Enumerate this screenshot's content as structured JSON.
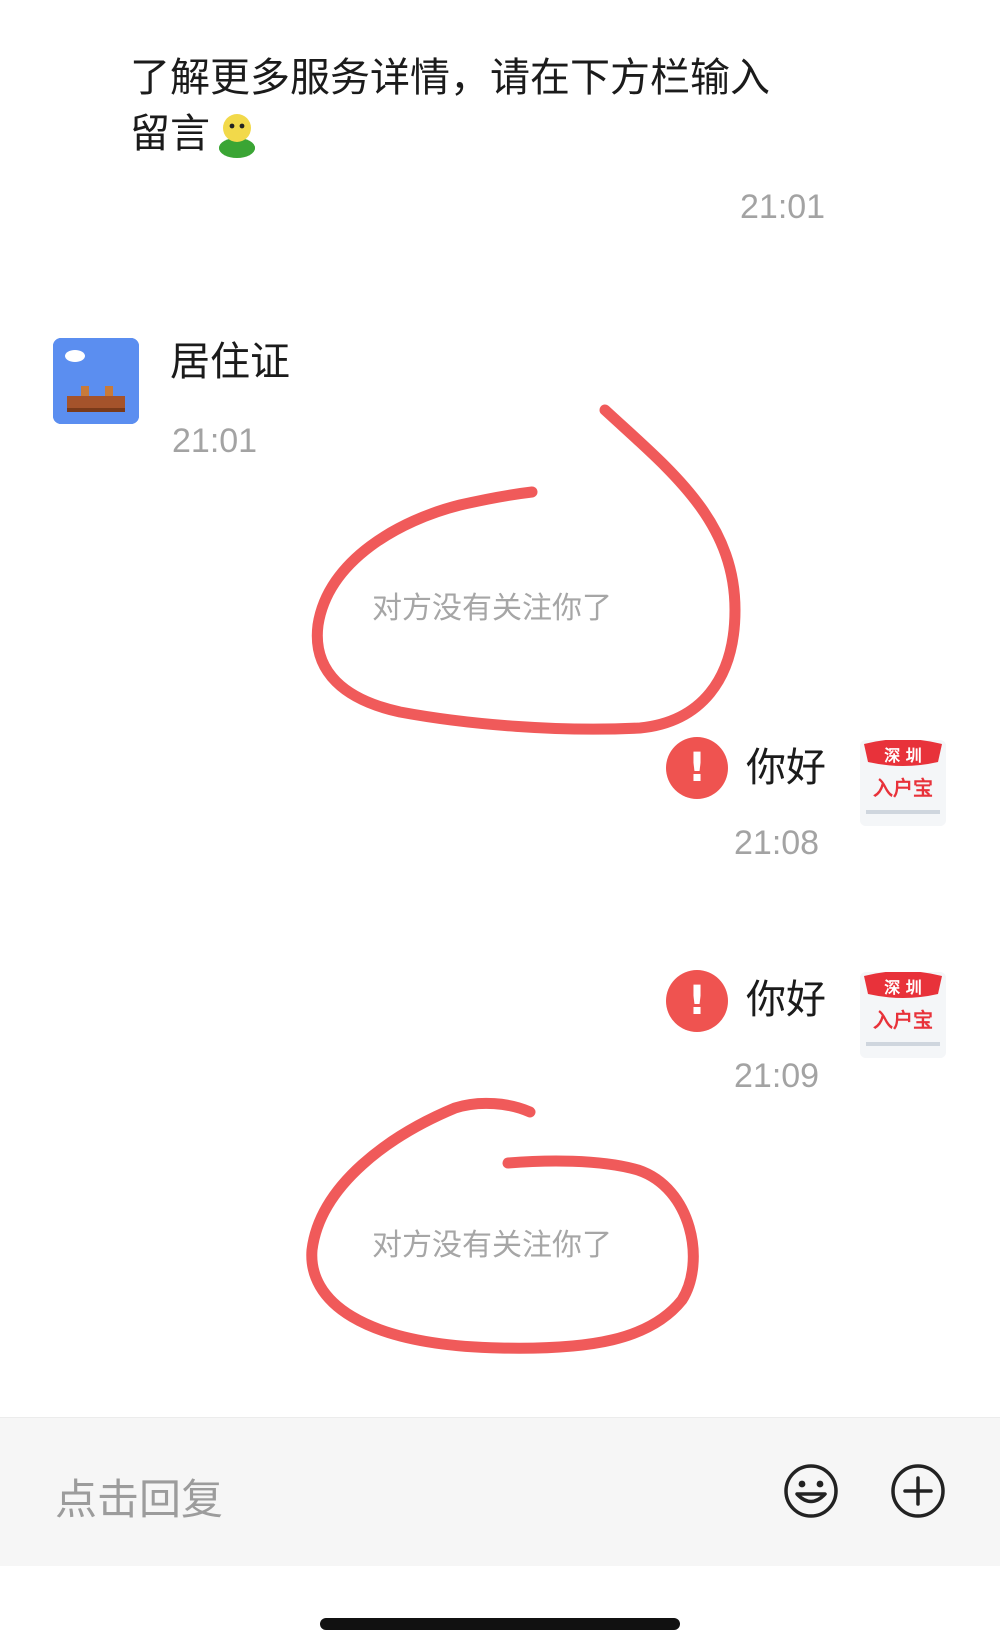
{
  "messages": {
    "intro": {
      "line1": "了解更多服务详情，请在下方栏输入",
      "line2": "留言",
      "emoji": "green-person-emoji",
      "time": "21:01"
    },
    "incoming": {
      "text": "居住证",
      "time": "21:01"
    },
    "system_notice_1": "对方没有关注你了",
    "outgoing_1": {
      "text": "你好",
      "status": "!",
      "time": "21:08"
    },
    "outgoing_2": {
      "text": "你好",
      "status": "!",
      "time": "21:09"
    },
    "system_notice_2": "对方没有关注你了"
  },
  "avatar_right": {
    "line1": "深 圳",
    "line2": "入户宝"
  },
  "input": {
    "placeholder": "点击回复",
    "emoji_button_icon": "smiley-icon",
    "plus_button_icon": "plus-icon"
  },
  "colors": {
    "annotation": "#f05a5a",
    "error": "#ef5350",
    "avatar_left_bg": "#5b8ef0"
  }
}
